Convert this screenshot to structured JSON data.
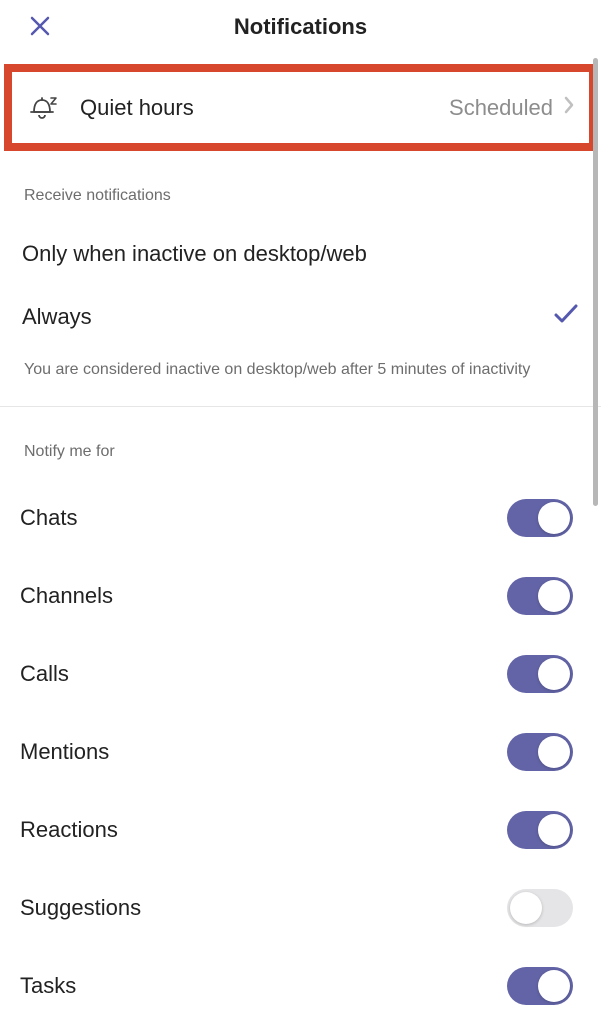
{
  "header": {
    "title": "Notifications"
  },
  "quietHours": {
    "label": "Quiet hours",
    "value": "Scheduled"
  },
  "receiveSection": {
    "header": "Receive notifications",
    "options": [
      {
        "label": "Only when inactive on desktop/web",
        "selected": false
      },
      {
        "label": "Always",
        "selected": true
      }
    ],
    "info": "You are considered inactive on desktop/web after 5 minutes of inactivity"
  },
  "notifySection": {
    "header": "Notify me for",
    "items": [
      {
        "label": "Chats",
        "on": true
      },
      {
        "label": "Channels",
        "on": true
      },
      {
        "label": "Calls",
        "on": true
      },
      {
        "label": "Mentions",
        "on": true
      },
      {
        "label": "Reactions",
        "on": true
      },
      {
        "label": "Suggestions",
        "on": false
      },
      {
        "label": "Tasks",
        "on": true
      }
    ]
  },
  "colors": {
    "accent": "#6264a7",
    "highlight": "#d7472e"
  }
}
